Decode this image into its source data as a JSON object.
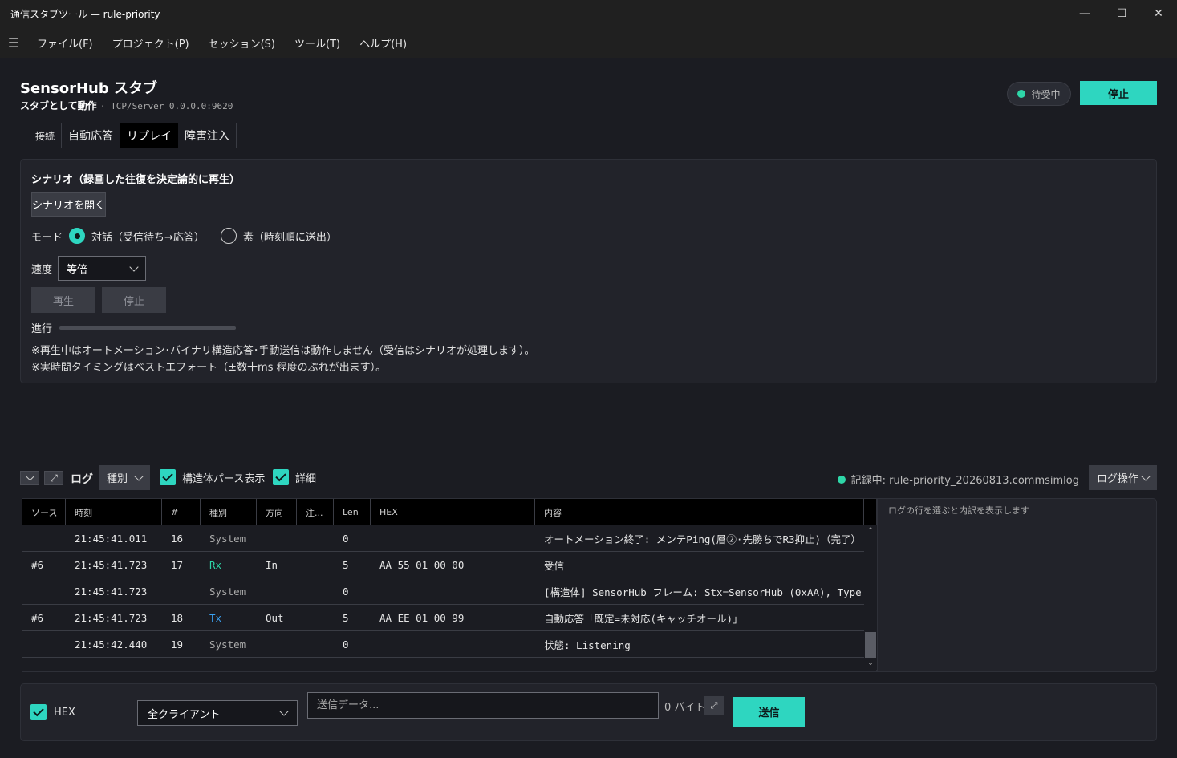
{
  "window": {
    "title": "通信スタブツール — rule-priority",
    "minimize": "—",
    "maximize": "☐",
    "close": "✕"
  },
  "menu": {
    "hamburger": "☰",
    "items": [
      "ファイル(F)",
      "プロジェクト(P)",
      "セッション(S)",
      "ツール(T)",
      "ヘルプ(H)"
    ]
  },
  "header": {
    "title": "SensorHub スタブ",
    "role": "スタブとして動作",
    "address": "· TCP/Server 0.0.0.0:9620",
    "status": "待受中",
    "stop_label": "停止"
  },
  "tabs": [
    "接続",
    "自動応答",
    "リプレイ",
    "障害注入"
  ],
  "scenario": {
    "title": "シナリオ（録画した往復を決定論的に再生）",
    "open_label": "シナリオを開く",
    "mode_label": "モード",
    "mode_interactive": "対話（受信待ち→応答）",
    "mode_raw": "素（時刻順に送出）",
    "speed_label": "速度",
    "speed_value": "等倍",
    "play_label": "再生",
    "stop_label": "停止",
    "progress_label": "進行",
    "progress": 0,
    "note1": "※再生中はオートメーション･バイナリ構造応答･手動送信は動作しません（受信はシナリオが処理します）。",
    "note2": "※実時間タイミングはベストエフォート（±数十ms 程度のぶれが出ます）。"
  },
  "logbar": {
    "collapse_icon": "⌄",
    "expand_icon": "⤢",
    "label": "ログ",
    "kind_label": "種別",
    "parse_label": "構造体パース表示",
    "detail_label": "詳細",
    "recording": "記録中: rule-priority_20260813.commsimlog",
    "ops_label": "ログ操作"
  },
  "log": {
    "columns": [
      "ソース",
      "時刻",
      "#",
      "種別",
      "方向",
      "注...",
      "Len",
      "HEX",
      "内容"
    ],
    "rows": [
      {
        "src": "",
        "time": "21:45:41.011",
        "num": "16",
        "kind": "System",
        "dir": "",
        "note": "",
        "len": "0",
        "hex": "",
        "content": "オートメーション終了: メンテPing(層②·先勝ちでR3抑止)（完了）"
      },
      {
        "src": "#6",
        "time": "21:45:41.723",
        "num": "17",
        "kind": "Rx",
        "dir": "In",
        "note": "",
        "len": "5",
        "hex": "AA 55 01 00 00",
        "content": "受信"
      },
      {
        "src": "",
        "time": "21:45:41.723",
        "num": "",
        "kind": "System",
        "dir": "",
        "note": "",
        "len": "0",
        "hex": "",
        "content": "[構造体] SensorHub フレーム: Stx=SensorHub (0xAA), Type"
      },
      {
        "src": "#6",
        "time": "21:45:41.723",
        "num": "18",
        "kind": "Tx",
        "dir": "Out",
        "note": "",
        "len": "5",
        "hex": "AA EE 01 00 99",
        "content": "自動応答「既定=未対応(キャッチオール)」"
      },
      {
        "src": "",
        "time": "21:45:42.440",
        "num": "19",
        "kind": "System",
        "dir": "",
        "note": "",
        "len": "0",
        "hex": "",
        "content": "状態: Listening"
      }
    ],
    "detail_hint": "ログの行を選ぶと内訳を表示します"
  },
  "send": {
    "hex_label": "HEX",
    "client": "全クライアント",
    "placeholder": "送信データ...",
    "bytes": "0 バイト",
    "send_label": "送信"
  },
  "colors": {
    "accent": "#2ed6c0",
    "rx": "#2ed6a8",
    "tx": "#3aa0f0",
    "system": "#aaaaaa"
  }
}
